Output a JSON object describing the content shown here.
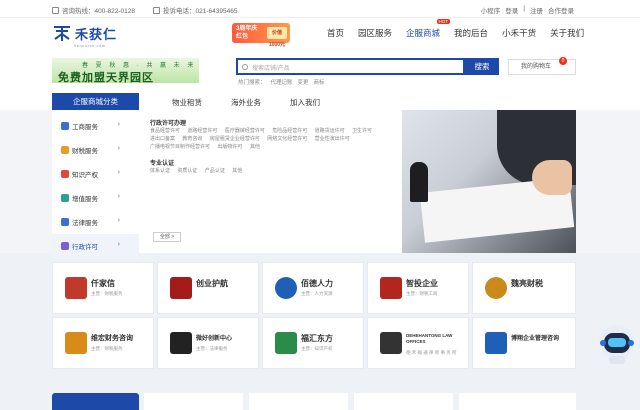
{
  "topbar": {
    "hotline": "咨询热线：400-822-0128",
    "complaint": "投诉电话：021-64395465",
    "links": [
      "小程序",
      "登录",
      "|",
      "注册",
      "合作登录"
    ]
  },
  "logo": {
    "name": "禾获仁",
    "sub": "hehuoren.com"
  },
  "promo": {
    "line1": "3周年庆",
    "line2": "红包",
    "amount": "价值1000元"
  },
  "nav": {
    "items": [
      "首页",
      "园区服务",
      "企服商城",
      "我的后台",
      "小禾干货",
      "关于我们"
    ],
    "active_index": 2,
    "hot_label": "HOT"
  },
  "banner": {
    "line1": "春 夏 秋 惠 · 共 赢 未 来",
    "line2": "免费加盟天界园区"
  },
  "search": {
    "placeholder": "搜索店铺/产品",
    "button": "搜索",
    "hotwords": [
      "热门搜索：",
      "代理记账",
      "变更",
      "商标"
    ]
  },
  "cart": {
    "label": "我的购物车",
    "count": "0"
  },
  "category_bar": {
    "title": "企服商城分类"
  },
  "subnav": {
    "items": [
      "物业租赁",
      "海外业务",
      "加入我们"
    ]
  },
  "categories": [
    {
      "label": "工商服务",
      "icon": "briefcase-icon",
      "color": "#3b6fd1"
    },
    {
      "label": "财税服务",
      "icon": "calculator-icon",
      "color": "#e79b2a"
    },
    {
      "label": "知识产权",
      "icon": "bulb-icon",
      "color": "#e0483a"
    },
    {
      "label": "增值服务",
      "icon": "shield-icon",
      "color": "#2aa198"
    },
    {
      "label": "法律服务",
      "icon": "gavel-icon",
      "color": "#3b6fd1"
    },
    {
      "label": "行政许可",
      "icon": "document-icon",
      "color": "#7b5ed6"
    }
  ],
  "panel": {
    "sec1": "行政许可办理",
    "links1": [
      "食品经营许可",
      "道路经营许可",
      "医疗器械经营许可",
      "危险品经营许可",
      "道路货运许可",
      "卫生许可",
      "进出口备案",
      "教育咨询",
      "房屋租赁企业经营许可",
      "网络文化经营许可",
      "营业性演出许可",
      "广播电视节目制作经营许可",
      "出版物许可",
      "其他"
    ],
    "sec2": "专业认证",
    "links2": [
      "体系认证",
      "资质认证",
      "产品认证",
      "其他"
    ],
    "more": "全部 >"
  },
  "cards": [
    {
      "name": "仟家信",
      "tag": "主营：财税服务",
      "color": "#c0392b"
    },
    {
      "name": "创业护航",
      "tag": "",
      "color": "#a31b1b"
    },
    {
      "name": "佰德人力",
      "tag": "主营：人力资源",
      "color": "#1f5fb5"
    },
    {
      "name": "智投企业",
      "tag": "主营：财税工商",
      "color": "#b3261e"
    },
    {
      "name": "魏亮财税",
      "tag": "",
      "color": "#c98a1b"
    },
    {
      "name": "维宏财务咨询",
      "tag": "主营：财税服务",
      "color": "#d98b1a"
    },
    {
      "name": "微好创新中心",
      "tag": "主营：法律服务",
      "color": "#222"
    },
    {
      "name": "福汇东方",
      "tag": "主营：知识产权",
      "color": "#2a8b4a"
    },
    {
      "name": "DEHEHANTONG LAW OFFICES",
      "tag": "德 禾 翰 通 律 师 事 务 所",
      "color": "#333"
    },
    {
      "name": "博翔企业管理咨询",
      "tag": "",
      "color": "#1f5fb5"
    }
  ]
}
